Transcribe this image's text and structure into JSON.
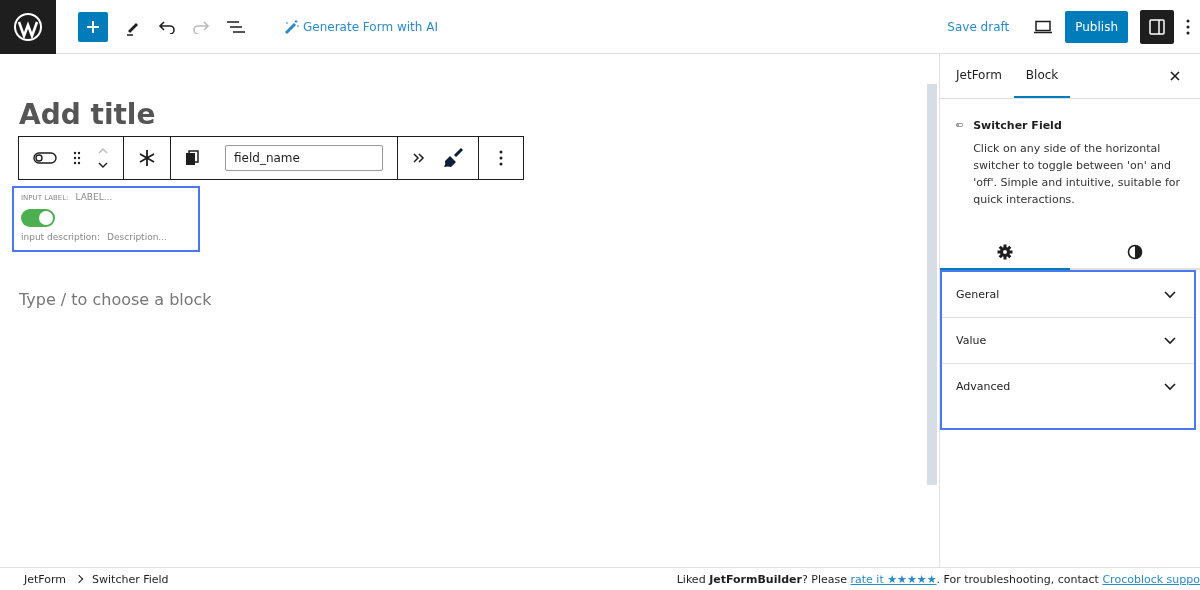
{
  "topbar": {
    "ai_button": "Generate Form with AI",
    "save_draft": "Save draft",
    "publish": "Publish",
    "settings_toggle": {
      "selected": true
    }
  },
  "editor": {
    "title_placeholder": "Add title",
    "block_toolbar": {
      "field_name": "field_name"
    },
    "field": {
      "label_caption": "INPUT LABEL:",
      "label_value": "LABEL...",
      "switch_on": true,
      "description_caption": "input description:",
      "description_value": "Description..."
    },
    "block_placeholder": "Type / to choose a block"
  },
  "sidebar": {
    "tabs": [
      {
        "label": "JetForm",
        "selected": false
      },
      {
        "label": "Block",
        "selected": true
      }
    ],
    "block_title": "Switcher Field",
    "block_description": "Click on any side of the horizontal switcher to toggle between 'on' and 'off'. Simple and intuitive, suitable for quick interactions.",
    "settings_tabs": [
      {
        "kind": "settings",
        "selected": true
      },
      {
        "kind": "styles",
        "selected": false
      }
    ],
    "panels": [
      {
        "title": "General",
        "expanded": false
      },
      {
        "title": "Value",
        "expanded": false
      },
      {
        "title": "Advanced",
        "expanded": false
      }
    ]
  },
  "footer": {
    "breadcrumbs": [
      "JetForm",
      "Switcher Field"
    ],
    "note_start": "Liked **JetFormBuilder**? Please ",
    "rate_link": "rate it ★★★★★",
    "note_middle": ". For troubleshooting, contact ",
    "support_link": "Crocoblock suppo"
  }
}
